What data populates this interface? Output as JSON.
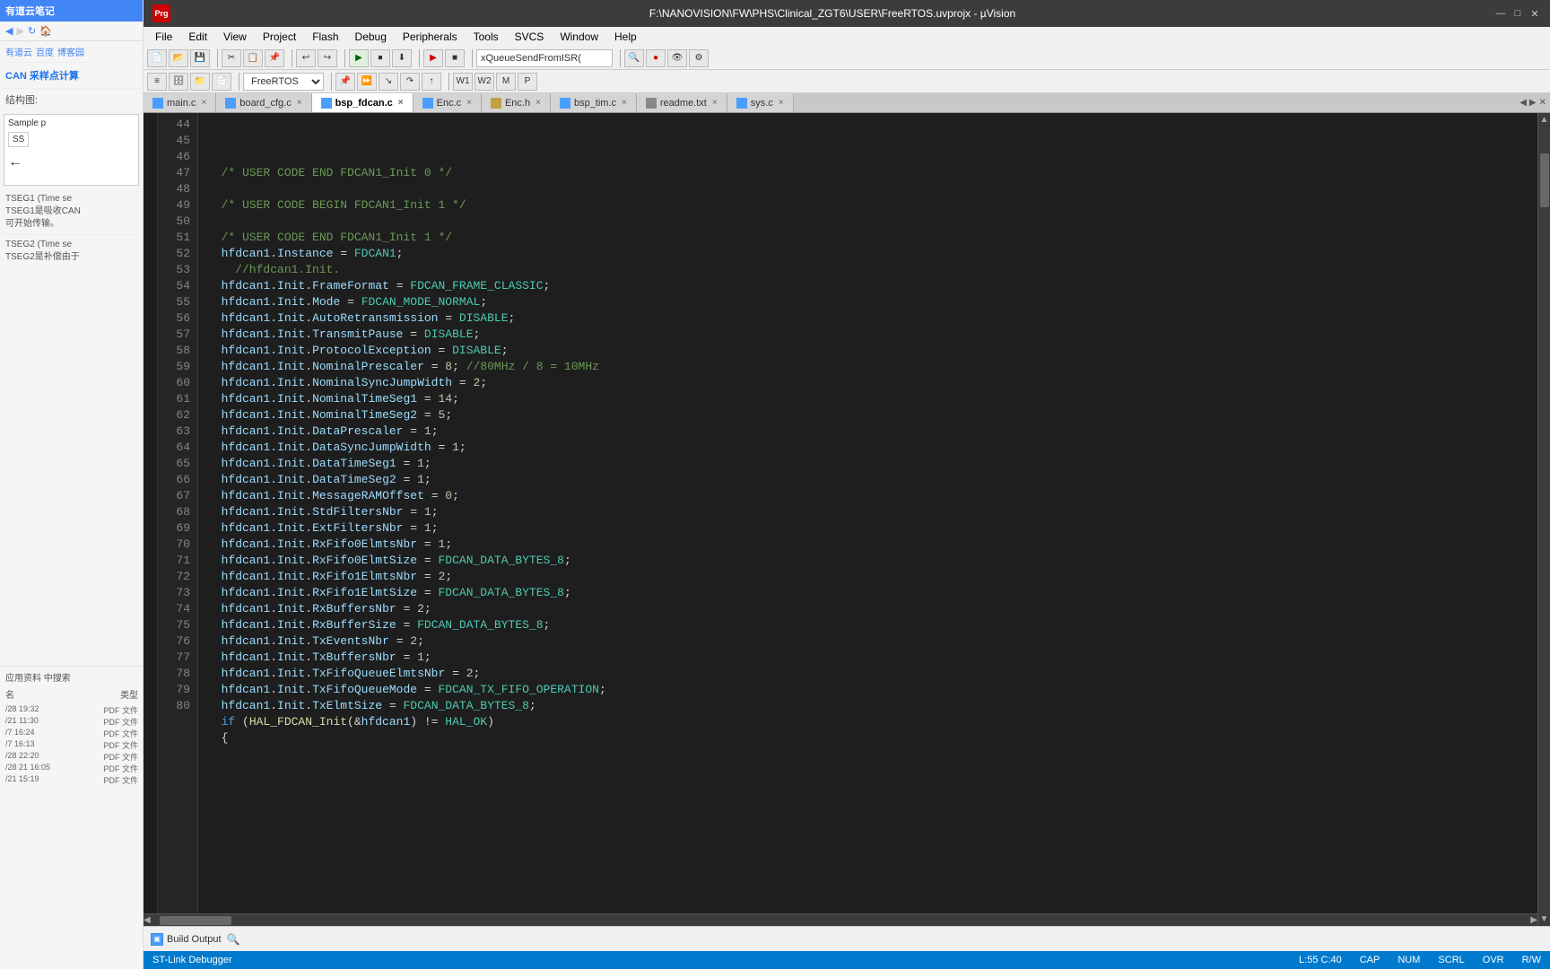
{
  "window": {
    "title": "F:\\NANOVISION\\FW\\PHS\\Clinical_ZGT6\\USER\\FreeRTOS.uvprojx - µVision",
    "titlebar_bg": "#3c3c3c"
  },
  "menu": {
    "items": [
      "File",
      "Edit",
      "View",
      "Project",
      "Flash",
      "Debug",
      "Peripherals",
      "Tools",
      "SVCS",
      "Window",
      "Help"
    ]
  },
  "toolbar": {
    "dropdown_value": "FreeRTOS"
  },
  "tabs": [
    {
      "label": "main.c",
      "active": false,
      "color": "#4a9eff"
    },
    {
      "label": "board_cfg.c",
      "active": false,
      "color": "#4a9eff"
    },
    {
      "label": "bsp_fdcan.c",
      "active": true,
      "color": "#4a9eff"
    },
    {
      "label": "Enc.c",
      "active": false,
      "color": "#4a9eff"
    },
    {
      "label": "Enc.h",
      "active": false,
      "color": "#c0a040"
    },
    {
      "label": "bsp_tim.c",
      "active": false,
      "color": "#4a9eff"
    },
    {
      "label": "readme.txt",
      "active": false,
      "color": "#888"
    },
    {
      "label": "sys.c",
      "active": false,
      "color": "#4a9eff"
    }
  ],
  "code": {
    "lines": [
      {
        "num": 44,
        "content": ""
      },
      {
        "num": 45,
        "content": "  /* USER CODE END FDCAN1_Init 0 */",
        "type": "comment"
      },
      {
        "num": 46,
        "content": ""
      },
      {
        "num": 47,
        "content": "  /* USER CODE BEGIN FDCAN1_Init 1 */",
        "type": "comment"
      },
      {
        "num": 48,
        "content": ""
      },
      {
        "num": 49,
        "content": "  /* USER CODE END FDCAN1_Init 1 */",
        "type": "comment"
      },
      {
        "num": 50,
        "content": "  hfdcan1.Instance = FDCAN1;",
        "type": "code"
      },
      {
        "num": 51,
        "content": "    //hfdcan1.Init.",
        "type": "comment-line"
      },
      {
        "num": 52,
        "content": "  hfdcan1.Init.FrameFormat = FDCAN_FRAME_CLASSIC;",
        "type": "code"
      },
      {
        "num": 53,
        "content": "  hfdcan1.Init.Mode = FDCAN_MODE_NORMAL;",
        "type": "code"
      },
      {
        "num": 54,
        "content": "  hfdcan1.Init.AutoRetransmission = DISABLE;",
        "type": "code"
      },
      {
        "num": 55,
        "content": "  hfdcan1.Init.TransmitPause = DISABLE;",
        "type": "code"
      },
      {
        "num": 56,
        "content": "  hfdcan1.Init.ProtocolException = DISABLE;",
        "type": "code"
      },
      {
        "num": 57,
        "content": "  hfdcan1.Init.NominalPrescaler = 8; //80MHz / 8 = 10MHz",
        "type": "code-comment"
      },
      {
        "num": 58,
        "content": "  hfdcan1.Init.NominalSyncJumpWidth = 2;",
        "type": "code"
      },
      {
        "num": 59,
        "content": "  hfdcan1.Init.NominalTimeSeg1 = 14;",
        "type": "code"
      },
      {
        "num": 60,
        "content": "  hfdcan1.Init.NominalTimeSeg2 = 5;",
        "type": "code"
      },
      {
        "num": 61,
        "content": "  hfdcan1.Init.DataPrescaler = 1;",
        "type": "code"
      },
      {
        "num": 62,
        "content": "  hfdcan1.Init.DataSyncJumpWidth = 1;",
        "type": "code"
      },
      {
        "num": 63,
        "content": "  hfdcan1.Init.DataTimeSeg1 = 1;",
        "type": "code"
      },
      {
        "num": 64,
        "content": "  hfdcan1.Init.DataTimeSeg2 = 1;",
        "type": "code"
      },
      {
        "num": 65,
        "content": "  hfdcan1.Init.MessageRAMOffset = 0;",
        "type": "code"
      },
      {
        "num": 66,
        "content": "  hfdcan1.Init.StdFiltersNbr = 1;",
        "type": "code"
      },
      {
        "num": 67,
        "content": "  hfdcan1.Init.ExtFiltersNbr = 1;",
        "type": "code"
      },
      {
        "num": 68,
        "content": "  hfdcan1.Init.RxFifo0ElmtsNbr = 1;",
        "type": "code"
      },
      {
        "num": 69,
        "content": "  hfdcan1.Init.RxFifo0ElmtSize = FDCAN_DATA_BYTES_8;",
        "type": "code"
      },
      {
        "num": 70,
        "content": "  hfdcan1.Init.RxFifo1ElmtsNbr = 2;",
        "type": "code"
      },
      {
        "num": 71,
        "content": "  hfdcan1.Init.RxFifo1ElmtSize = FDCAN_DATA_BYTES_8;",
        "type": "code"
      },
      {
        "num": 72,
        "content": "  hfdcan1.Init.RxBuffersNbr = 2;",
        "type": "code"
      },
      {
        "num": 73,
        "content": "  hfdcan1.Init.RxBufferSize = FDCAN_DATA_BYTES_8;",
        "type": "code"
      },
      {
        "num": 74,
        "content": "  hfdcan1.Init.TxEventsNbr = 2;",
        "type": "code"
      },
      {
        "num": 75,
        "content": "  hfdcan1.Init.TxBuffersNbr = 1;",
        "type": "code"
      },
      {
        "num": 76,
        "content": "  hfdcan1.Init.TxFifoQueueElmtsNbr = 2;",
        "type": "code"
      },
      {
        "num": 77,
        "content": "  hfdcan1.Init.TxFifoQueueMode = FDCAN_TX_FIFO_OPERATION;",
        "type": "code"
      },
      {
        "num": 78,
        "content": "  hfdcan1.Init.TxElmtSize = FDCAN_DATA_BYTES_8;",
        "type": "code"
      },
      {
        "num": 79,
        "content": "  if (HAL_FDCAN_Init(&hfdcan1) != HAL_OK)",
        "type": "code"
      },
      {
        "num": 80,
        "content": "  {",
        "type": "code"
      }
    ]
  },
  "status_bar": {
    "debugger": "ST-Link Debugger",
    "position": "L:55 C:40",
    "cap": "CAP",
    "num": "NUM",
    "scrl": "SCRL",
    "ovr": "OVR",
    "rw": "R/W"
  },
  "bottom_panel": {
    "build_output_label": "Build Output"
  },
  "sidebar": {
    "app_name": "有道云笔记",
    "items": [
      "有道云",
      "百度",
      "博客园"
    ],
    "label1": "CAN 采样点计算",
    "label2": "结构图:",
    "label3": "Sample p",
    "label4": "SS",
    "label5": "TSEG1 (Time se",
    "label6": "TSEG1是吸收CAN",
    "label7": "可开始传输。",
    "label8": "TSEG2 (Time se",
    "label9": "TSEG2是补偿由于"
  }
}
